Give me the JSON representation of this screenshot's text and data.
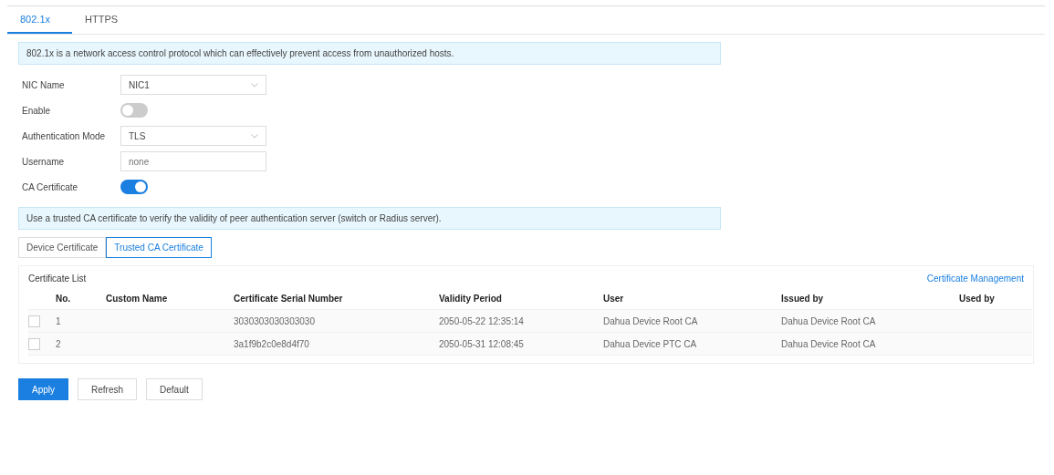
{
  "tabs": [
    {
      "label": "802.1x",
      "selected": true
    },
    {
      "label": "HTTPS",
      "selected": false
    }
  ],
  "intro_notice": "802.1x is a network access control protocol which can effectively prevent access from unauthorized hosts.",
  "form": [
    {
      "kind": "select",
      "label": "NIC Name",
      "value": "NIC1"
    },
    {
      "kind": "switch",
      "label": "Enable",
      "on": false
    },
    {
      "kind": "select",
      "label": "Authentication Mode",
      "value": "TLS"
    },
    {
      "kind": "input",
      "label": "Username",
      "placeholder": "none"
    },
    {
      "kind": "switch",
      "label": "CA Certificate",
      "on": true
    }
  ],
  "ca_notice": "Use a trusted CA certificate to verify the validity of peer authentication server (switch or Radius server).",
  "cert_tabs": [
    {
      "label": "Device Certificate",
      "selected": false
    },
    {
      "label": "Trusted CA Certificate",
      "selected": true
    }
  ],
  "certificate_list": {
    "title": "Certificate List",
    "management_link": "Certificate Management",
    "columns": [
      "No.",
      "Custom Name",
      "Certificate Serial Number",
      "Validity Period",
      "User",
      "Issued by",
      "Used by"
    ],
    "rows": [
      {
        "checked": false,
        "cells": [
          "1",
          null,
          "3030303030303030",
          "2050-05-22 12:35:14",
          "Dahua Device Root CA",
          "Dahua Device Root CA",
          null
        ]
      },
      {
        "checked": false,
        "cells": [
          "2",
          null,
          "3a1f9b2c0e8d4f70",
          "2050-05-31 12:08:45",
          "Dahua Device PTC CA",
          "Dahua Device Root CA",
          null
        ]
      }
    ]
  },
  "buttons": [
    {
      "label": "Apply",
      "kind": "primary"
    },
    {
      "label": "Refresh",
      "kind": "default"
    },
    {
      "label": "Default",
      "kind": "default"
    }
  ]
}
